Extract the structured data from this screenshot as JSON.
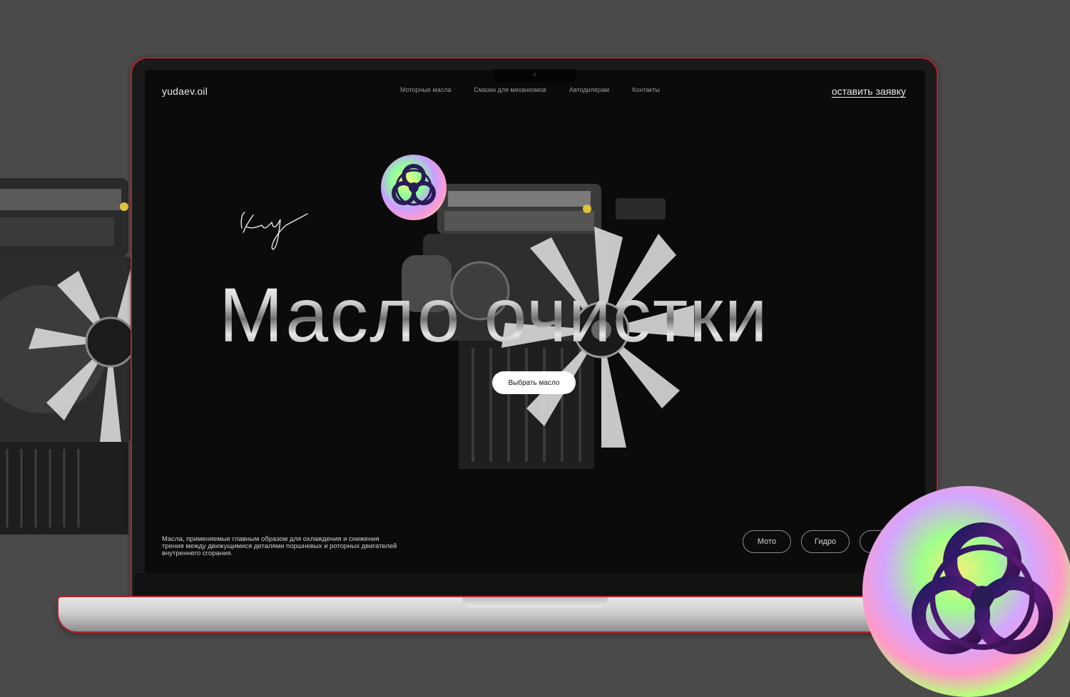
{
  "site": {
    "logo": "yudaev.oil",
    "nav": [
      "Моторные масла",
      "Смазки для механизмов",
      "Автодилерам",
      "Контакты"
    ],
    "cta_link": "оставить заявку"
  },
  "hero": {
    "title": "Масло очистки",
    "button_label": "Выбрать масло",
    "description": "Масла, применяемые главным образом для охлаждения и снижения трения между движущимися деталями поршневых и роторных двигателей внутреннего сгорания."
  },
  "categories": [
    "Мото",
    "Гидро",
    ""
  ],
  "colors": {
    "background": "#4a4a4a",
    "screen": "#0b0b0c",
    "laptop_accent": "#b8232b",
    "text_light": "#e8e8e8"
  },
  "icons": [
    "biohazard-icon",
    "engine-image",
    "signature-mark"
  ]
}
